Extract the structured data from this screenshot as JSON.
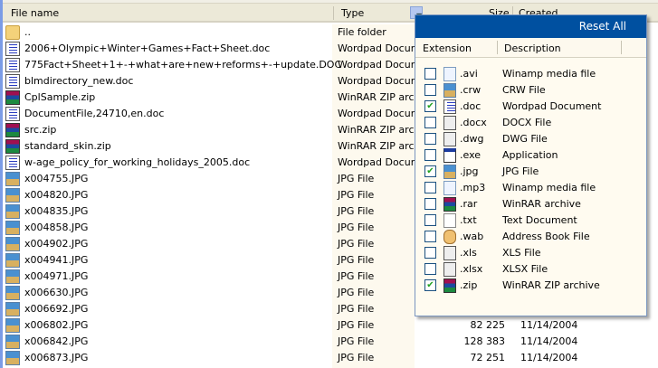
{
  "columns": {
    "name": "File name",
    "type": "Type",
    "size": "Size",
    "created": "Created"
  },
  "files": [
    {
      "name": "..",
      "type": "File folder",
      "icon": "folder",
      "size": "",
      "created": ""
    },
    {
      "name": "2006+Olympic+Winter+Games+Fact+Sheet.doc",
      "type": "Wordpad Docum.",
      "icon": "doc",
      "size": "",
      "created": ""
    },
    {
      "name": "775Fact+Sheet+1+-+what+are+new+reforms+-+update.DOC",
      "type": "Wordpad Docum.",
      "icon": "doc",
      "size": "",
      "created": ""
    },
    {
      "name": "blmdirectory_new.doc",
      "type": "Wordpad Docum.",
      "icon": "doc",
      "size": "",
      "created": ""
    },
    {
      "name": "CplSample.zip",
      "type": "WinRAR ZIP arc..",
      "icon": "zip",
      "size": "",
      "created": ""
    },
    {
      "name": "DocumentFile,24710,en.doc",
      "type": "Wordpad Docum.",
      "icon": "doc",
      "size": "",
      "created": ""
    },
    {
      "name": "src.zip",
      "type": "WinRAR ZIP arc..",
      "icon": "zip",
      "size": "",
      "created": ""
    },
    {
      "name": "standard_skin.zip",
      "type": "WinRAR ZIP arc..",
      "icon": "zip",
      "size": "",
      "created": ""
    },
    {
      "name": "w-age_policy_for_working_holidays_2005.doc",
      "type": "Wordpad Docum.",
      "icon": "doc",
      "size": "",
      "created": ""
    },
    {
      "name": "x004755.JPG",
      "type": "JPG File",
      "icon": "jpg",
      "size": "",
      "created": ""
    },
    {
      "name": "x004820.JPG",
      "type": "JPG File",
      "icon": "jpg",
      "size": "",
      "created": ""
    },
    {
      "name": "x004835.JPG",
      "type": "JPG File",
      "icon": "jpg",
      "size": "",
      "created": ""
    },
    {
      "name": "x004858.JPG",
      "type": "JPG File",
      "icon": "jpg",
      "size": "",
      "created": ""
    },
    {
      "name": "x004902.JPG",
      "type": "JPG File",
      "icon": "jpg",
      "size": "",
      "created": ""
    },
    {
      "name": "x004941.JPG",
      "type": "JPG File",
      "icon": "jpg",
      "size": "",
      "created": ""
    },
    {
      "name": "x004971.JPG",
      "type": "JPG File",
      "icon": "jpg",
      "size": "",
      "created": ""
    },
    {
      "name": "x006630.JPG",
      "type": "JPG File",
      "icon": "jpg",
      "size": "",
      "created": ""
    },
    {
      "name": "x006692.JPG",
      "type": "JPG File",
      "icon": "jpg",
      "size": "",
      "created": ""
    },
    {
      "name": "x006802.JPG",
      "type": "JPG File",
      "icon": "jpg",
      "size": "82 225",
      "created": "11/14/2004"
    },
    {
      "name": "x006842.JPG",
      "type": "JPG File",
      "icon": "jpg",
      "size": "128 383",
      "created": "11/14/2004"
    },
    {
      "name": "x006873.JPG",
      "type": "JPG File",
      "icon": "jpg",
      "size": "72 251",
      "created": "11/14/2004"
    }
  ],
  "filter": {
    "reset_label": "Reset All",
    "col_ext": "Extension",
    "col_desc": "Description",
    "items": [
      {
        "ext": ".avi",
        "desc": "Winamp media file",
        "checked": false,
        "icon": "snd"
      },
      {
        "ext": ".crw",
        "desc": "CRW File",
        "checked": false,
        "icon": "jpg"
      },
      {
        "ext": ".doc",
        "desc": "Wordpad Document",
        "checked": true,
        "icon": "doc"
      },
      {
        "ext": ".docx",
        "desc": "DOCX File",
        "checked": false,
        "icon": "xl"
      },
      {
        "ext": ".dwg",
        "desc": "DWG File",
        "checked": false,
        "icon": "xl"
      },
      {
        "ext": ".exe",
        "desc": "Application",
        "checked": false,
        "icon": "app"
      },
      {
        "ext": ".jpg",
        "desc": "JPG File",
        "checked": true,
        "icon": "jpg"
      },
      {
        "ext": ".mp3",
        "desc": "Winamp media file",
        "checked": false,
        "icon": "snd"
      },
      {
        "ext": ".rar",
        "desc": "WinRAR archive",
        "checked": false,
        "icon": "zip"
      },
      {
        "ext": ".txt",
        "desc": "Text Document",
        "checked": false,
        "icon": "txt"
      },
      {
        "ext": ".wab",
        "desc": "Address Book File",
        "checked": false,
        "icon": "wab"
      },
      {
        "ext": ".xls",
        "desc": "XLS File",
        "checked": false,
        "icon": "xl"
      },
      {
        "ext": ".xlsx",
        "desc": "XLSX File",
        "checked": false,
        "icon": "xl"
      },
      {
        "ext": ".zip",
        "desc": "WinRAR ZIP archive",
        "checked": true,
        "icon": "zip"
      }
    ]
  }
}
